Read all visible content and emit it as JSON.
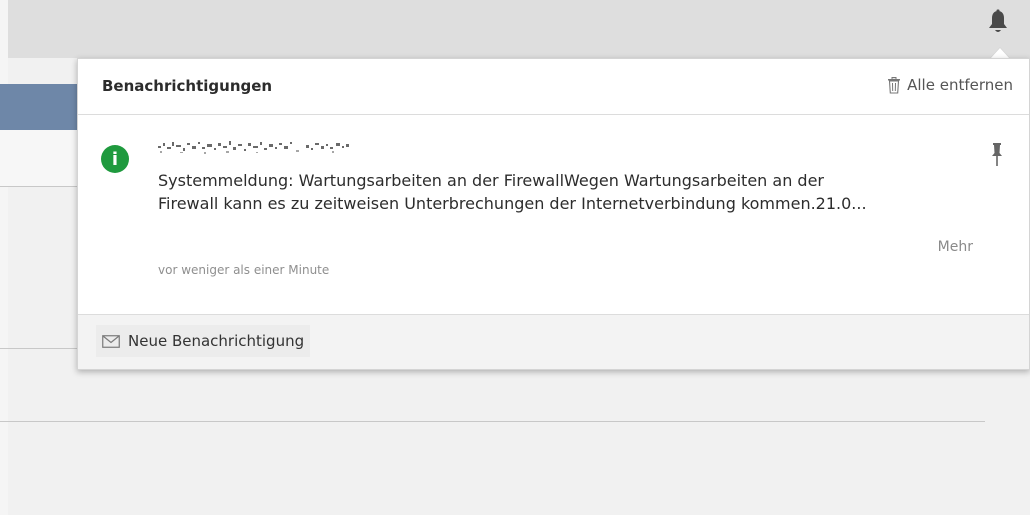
{
  "notifications": {
    "title": "Benachrichtigungen",
    "clear_all_label": "Alle entfernen",
    "items": [
      {
        "icon": "info-icon",
        "icon_color": "#1f9a3e",
        "line1": "Systemmeldung: Wartungsarbeiten an der FirewallWegen Wartungsarbeiten an der",
        "line2": "Firewall kann es zu zeitweisen Unterbrechungen der Internetverbindung kommen.21.0...",
        "more_label": "Mehr",
        "time": "vor weniger als einer Minute"
      }
    ],
    "new_notification_label": "Neue Benachrichtigung"
  },
  "icons": {
    "bell": "bell-icon",
    "trash": "trash-icon",
    "pin": "pin-icon",
    "envelope": "envelope-icon"
  },
  "colors": {
    "accent_green": "#1f9a3e",
    "topbar": "#dedede",
    "blue_bar": "#6e87a8"
  }
}
